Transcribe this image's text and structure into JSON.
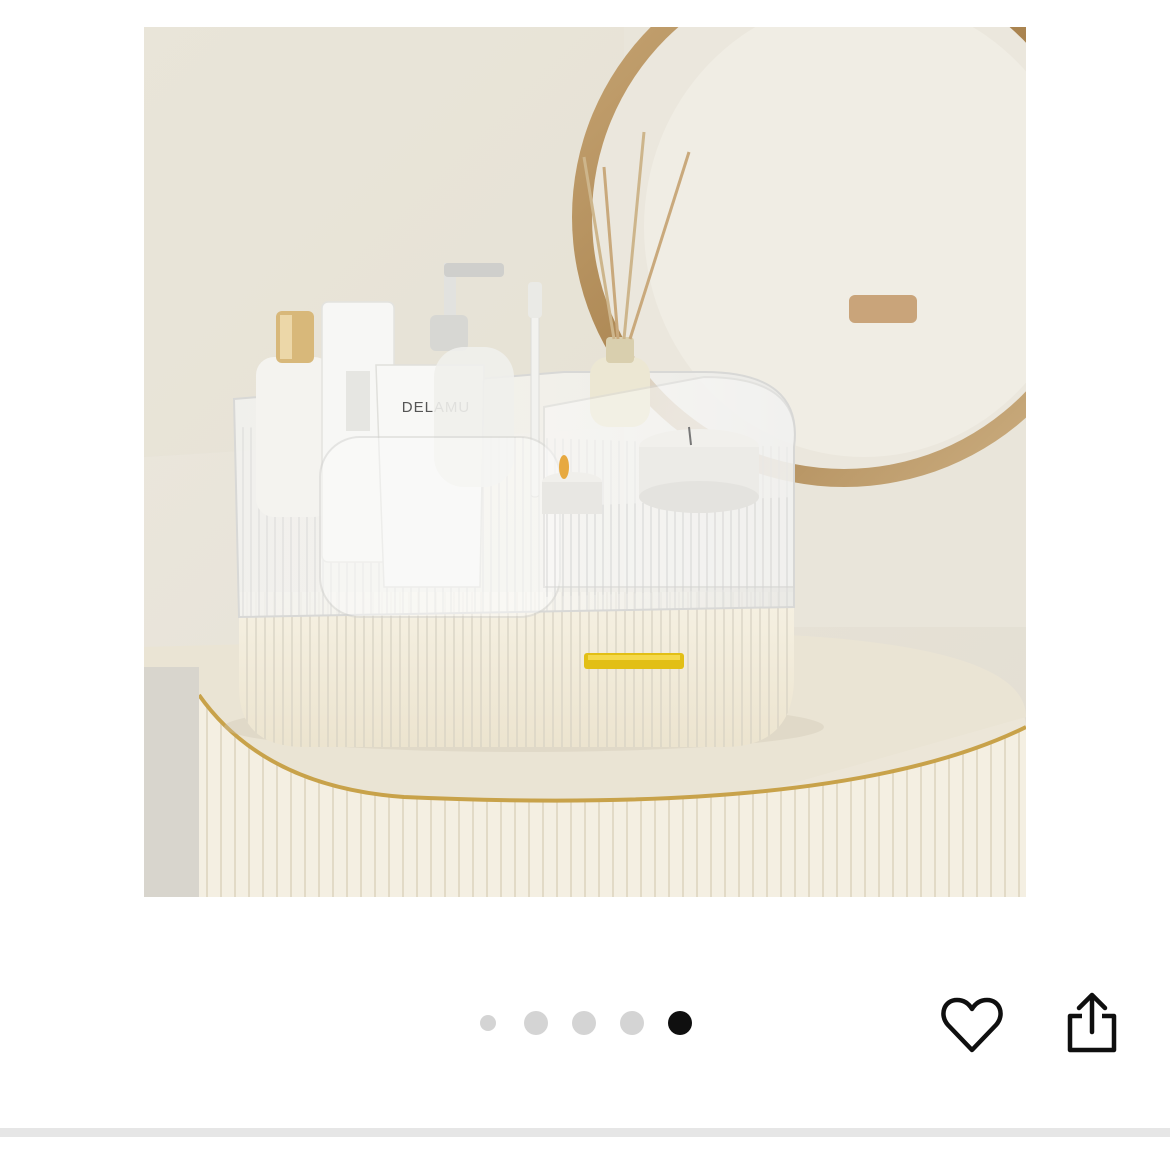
{
  "product_image": {
    "package_brand_text": "DELAMU",
    "icon": "product-photo"
  },
  "carousel": {
    "total": 5,
    "active_index": 4,
    "active_color": "#0f0f0f",
    "inactive_color": "#d4d4d4"
  },
  "actions": {
    "wishlist_icon": "heart-outline-icon",
    "share_icon": "share-icon"
  },
  "colors": {
    "accent_gold": "#c8a24a",
    "background": "#ffffff",
    "divider": "#e6e6e6"
  }
}
